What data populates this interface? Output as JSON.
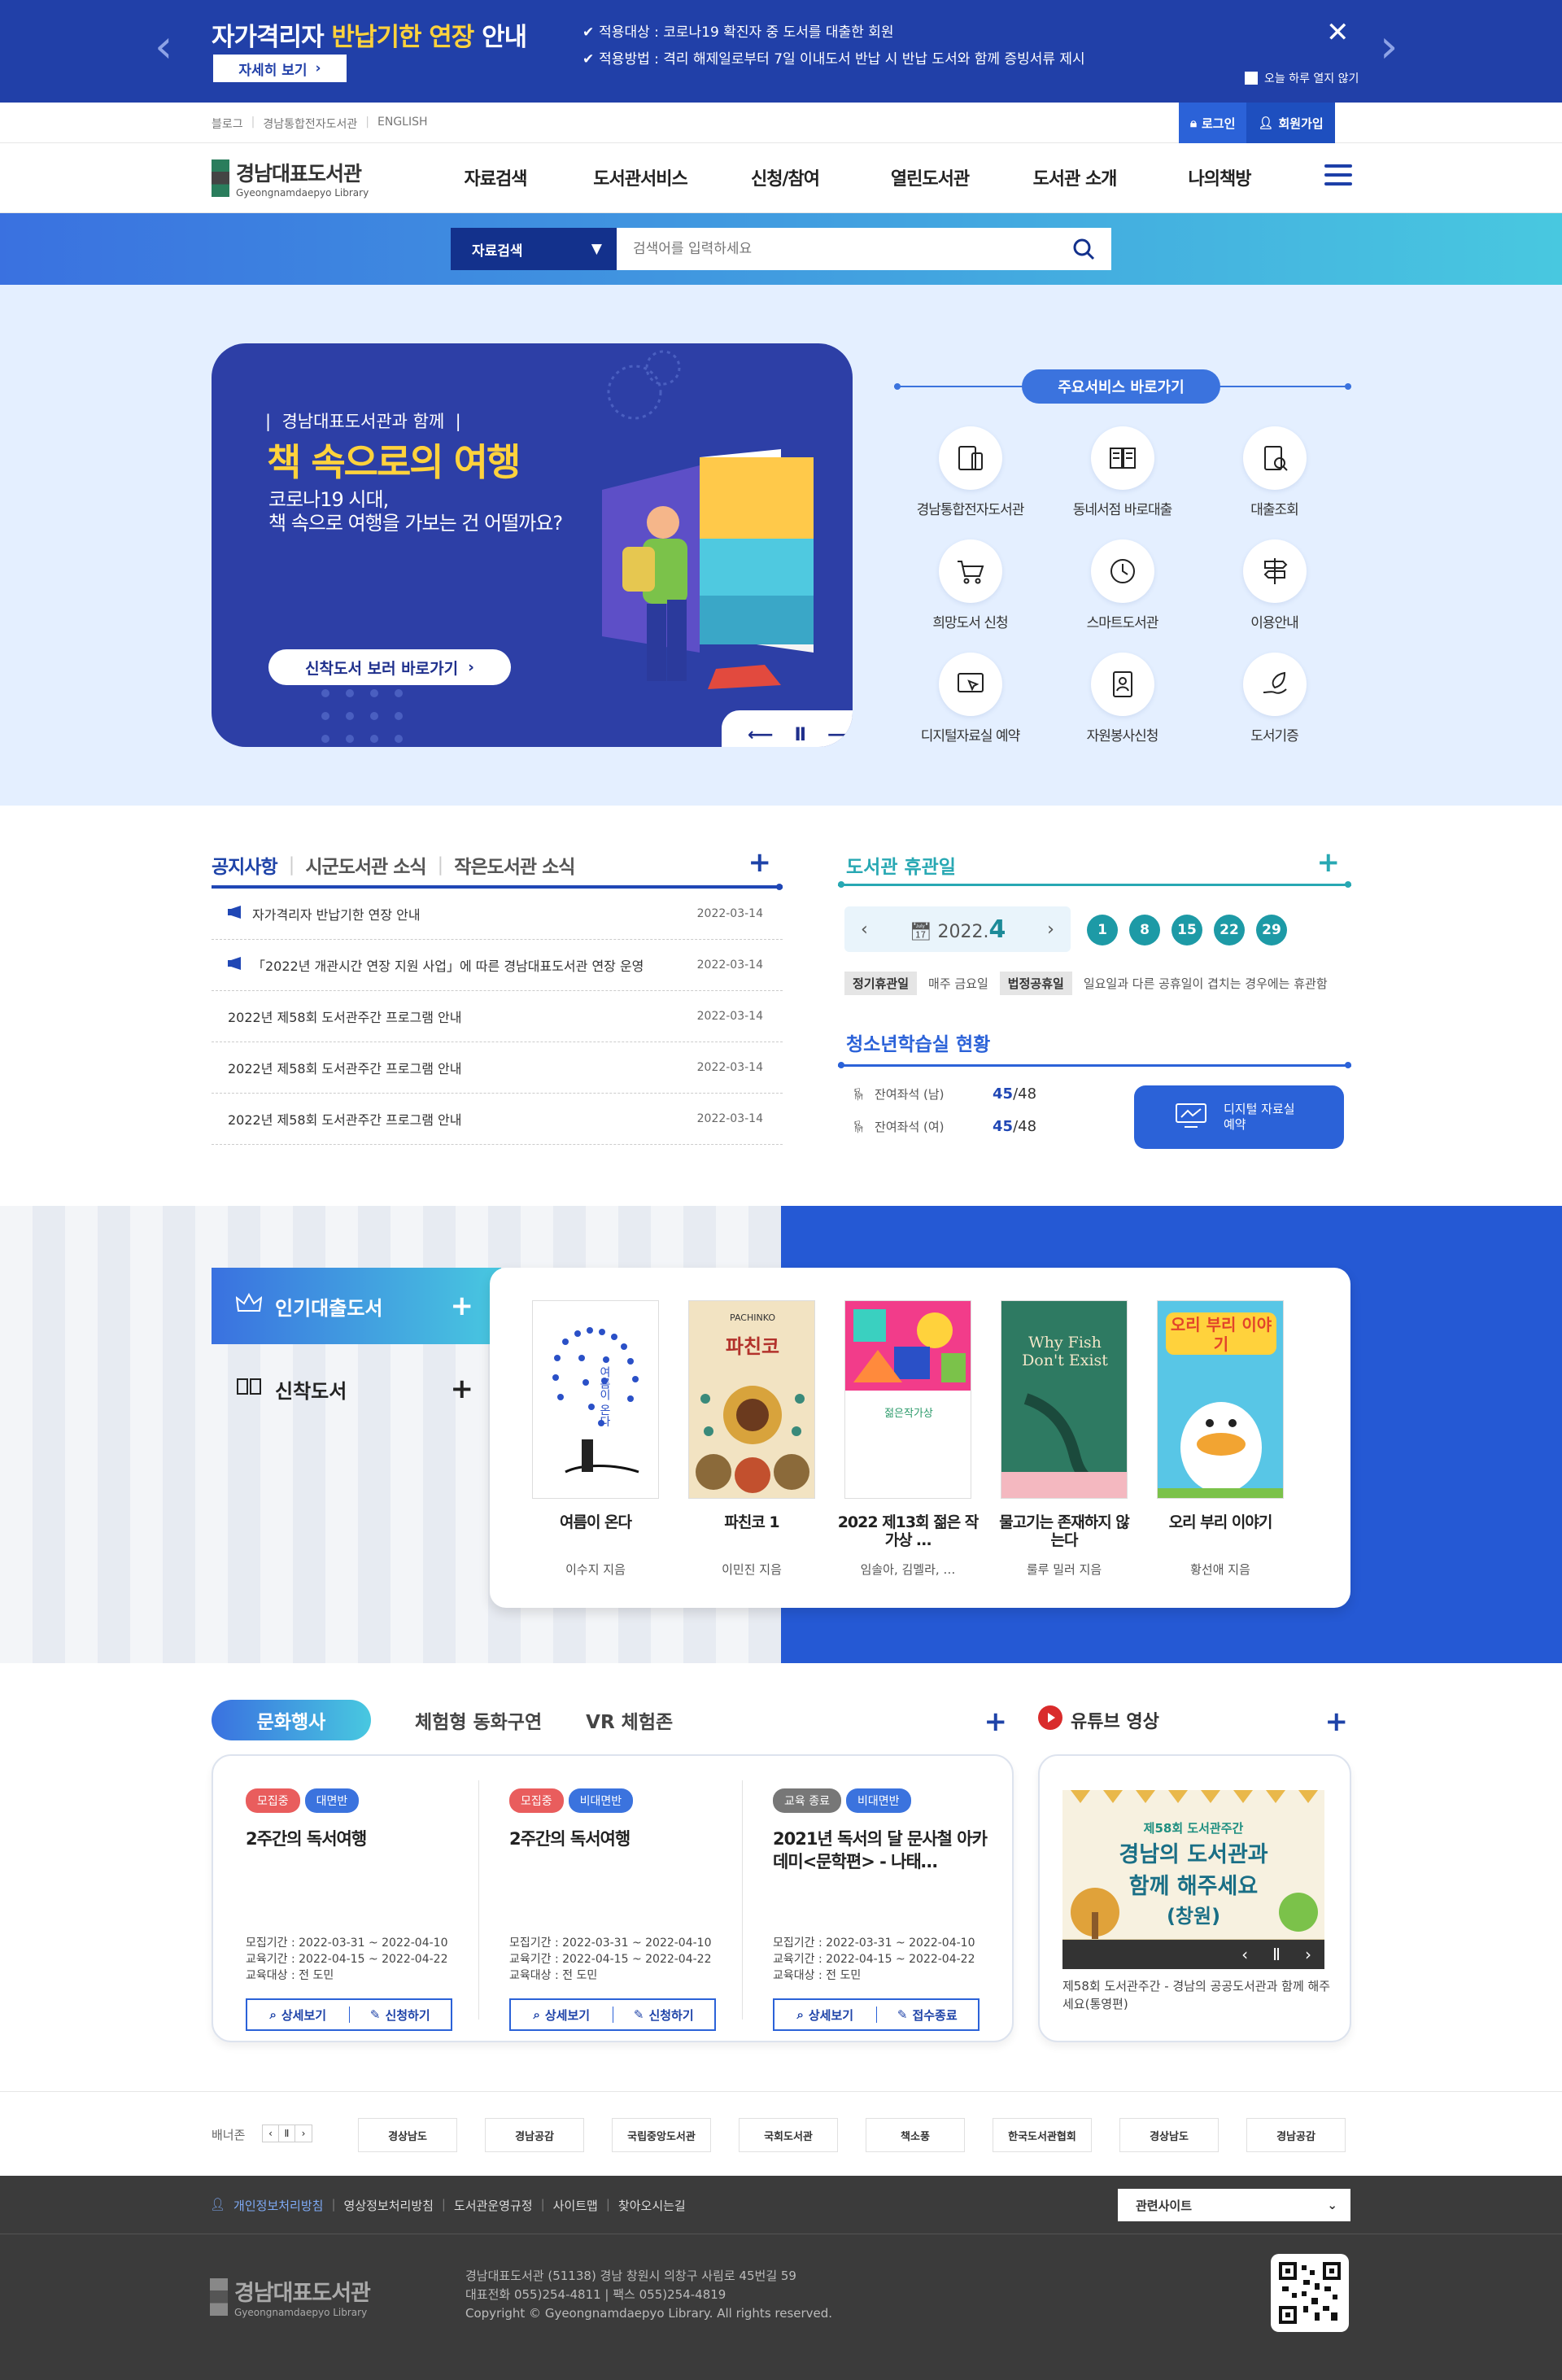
{
  "notice": {
    "title_plain": "자가격리자 ",
    "title_highlight": "반납기한 연장",
    "title_end": " 안내",
    "more": "자세히 보기",
    "items": [
      "적용대상 : 코로나19 확진자 중 도서를 대출한 회원",
      "적용방법 : 격리 해제일로부터 7일 이내도서 반납 시 반납 도서와 함께 증빙서류 제시"
    ],
    "no_show": "오늘 하루 열지 않기"
  },
  "util": {
    "links": [
      "블로그",
      "경남통합전자도서관",
      "ENGLISH"
    ],
    "login": "로그인",
    "join": "회원가입"
  },
  "gnb": {
    "logo_ko": "경남대표도서관",
    "logo_en": "Gyeongnamdaepyo Library",
    "menu": [
      "자료검색",
      "도서관서비스",
      "신청/참여",
      "열린도서관",
      "도서관 소개",
      "나의책방"
    ]
  },
  "search": {
    "category": "자료검색",
    "placeholder": "검색어를 입력하세요"
  },
  "hero": {
    "sub": "경남대표도서관과 함께",
    "title": "책 속으로의 여행",
    "desc1": "코로나19 시대,",
    "desc2": "책 속으로 여행을 가보는 건 어떨까요?",
    "btn": "신착도서 보러 바로가기"
  },
  "quick": {
    "title": "주요서비스 바로가기",
    "items": [
      "경남통합전자도서관",
      "동네서점 바로대출",
      "대출조회",
      "희망도서 신청",
      "스마트도서관",
      "이용안내",
      "디지털자료실 예약",
      "자원봉사신청",
      "도서기증"
    ]
  },
  "board": {
    "tabs": [
      "공지사항",
      "시군도서관 소식",
      "작은도서관 소식"
    ],
    "posts": [
      {
        "title": "자가격리자 반납기한 연장 안내",
        "date": "2022-03-14",
        "notice": true
      },
      {
        "title": "「2022년 개관시간 연장 지원 사업」에 따른 경남대표도서관 연장 운영",
        "date": "2022-03-14",
        "notice": true
      },
      {
        "title": "2022년 제58회 도서관주간 프로그램 안내",
        "date": "2022-03-14",
        "notice": false
      },
      {
        "title": "2022년 제58회 도서관주간 프로그램 안내",
        "date": "2022-03-14",
        "notice": false
      },
      {
        "title": "2022년 제58회 도서관주간 프로그램 안내",
        "date": "2022-03-14",
        "notice": false
      }
    ]
  },
  "holiday": {
    "title": "도서관 휴관일",
    "year": "2022.",
    "month": "4",
    "days": [
      "1",
      "8",
      "15",
      "22",
      "29"
    ],
    "regular_tag": "정기휴관일",
    "regular": "매주 금요일",
    "legal_tag": "법정공휴일",
    "legal": "일요일과 다른 공휴일이 겹치는 경우에는 휴관함"
  },
  "study": {
    "title": "청소년학습실 현황",
    "seats": [
      {
        "label": "잔여좌석 (남)",
        "avail": "45",
        "total": "/48"
      },
      {
        "label": "잔여좌석 (여)",
        "avail": "45",
        "total": "/48"
      }
    ],
    "btn1": "디지털 자료실",
    "btn2": "예약"
  },
  "books": {
    "tab_popular": "인기대출도서",
    "tab_new": "신착도서",
    "items": [
      {
        "title": "여름이 온다",
        "author": "이수지 지음",
        "cover_text": "여름이 온다"
      },
      {
        "title": "파친코 1",
        "author": "이민진 지음",
        "cover_text": "파친코"
      },
      {
        "title": "2022 제13회 젊은 작가상 …",
        "author": "임솔아, 김멜라, …",
        "cover_text": "젊은작가상"
      },
      {
        "title": "물고기는 존재하지 않는다",
        "author": "룰루 밀러 지음",
        "cover_text": "Why Fish Don't Exist"
      },
      {
        "title": "오리 부리 이야기",
        "author": "황선애 지음",
        "cover_text": "오리 부리 이야기"
      }
    ]
  },
  "culture": {
    "tabs": [
      "문화행사",
      "체험형 동화구연",
      "VR 체험존"
    ],
    "events": [
      {
        "tags": [
          "모집중",
          "대면반"
        ],
        "tag_colors": [
          "#e95d5d",
          "#3b73de"
        ],
        "title": "2주간의 독서여행",
        "recruit": "모집기간 : 2022-03-31 ~ 2022-04-10",
        "period": "교육기간 : 2022-04-15 ~ 2022-04-22",
        "target": "교육대상 : 전 도민",
        "btn1": "상세보기",
        "btn2": "신청하기"
      },
      {
        "tags": [
          "모집중",
          "비대면반"
        ],
        "tag_colors": [
          "#e95d5d",
          "#3b73de"
        ],
        "title": "2주간의 독서여행",
        "recruit": "모집기간 : 2022-03-31 ~ 2022-04-10",
        "period": "교육기간 : 2022-04-15 ~ 2022-04-22",
        "target": "교육대상 : 전 도민",
        "btn1": "상세보기",
        "btn2": "신청하기"
      },
      {
        "tags": [
          "교육 종료",
          "비대면반"
        ],
        "tag_colors": [
          "#777777",
          "#3b73de"
        ],
        "title": "2021년 독서의 달 문사철 아카데미<문학편> - 나태…",
        "recruit": "모집기간 : 2022-03-31 ~ 2022-04-10",
        "period": "교육기간 : 2022-04-15 ~ 2022-04-22",
        "target": "교육대상 : 전 도민",
        "btn1": "상세보기",
        "btn2": "접수종료"
      }
    ]
  },
  "youtube": {
    "title": "유튜브 영상",
    "thumb_line1": "제58회 도서관주간",
    "thumb_line2": "경남의 도서관과",
    "thumb_line3": "함께 해주세요",
    "thumb_line4": "(창원)",
    "caption": "제58회 도서관주간 - 경남의 공공도서관과 함께 해주세요(통영편)"
  },
  "banners": {
    "label": "배너존",
    "items": [
      "경상남도",
      "경남공감",
      "국립중앙도서관",
      "국회도서관",
      "책소풍",
      "한국도서관협회",
      "경상남도",
      "경남공감"
    ]
  },
  "footer": {
    "links": [
      "개인정보처리방침",
      "영상정보처리방침",
      "도서관운영규정",
      "사이트맵",
      "찾아오시는길"
    ],
    "related": "관련사이트",
    "logo_ko": "경남대표도서관",
    "logo_en": "Gyeongnamdaepyo Library",
    "addr1": "경남대표도서관  (51138) 경남 창원시 의창구 사림로 45번길 59",
    "addr2": "대표전화 055)254-4811 | 팩스 055)254-4819",
    "copy": "Copyright © Gyeongnamdaepyo Library. All rights reserved."
  }
}
